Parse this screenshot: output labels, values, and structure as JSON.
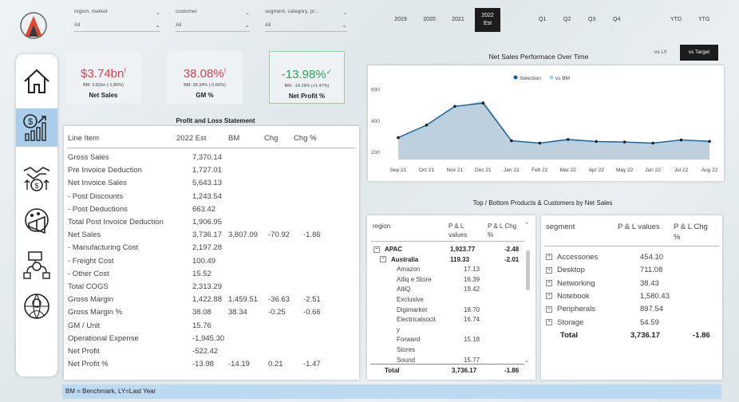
{
  "filters": [
    {
      "label": "region, market",
      "value": "All"
    },
    {
      "label": "customer",
      "value": "All"
    },
    {
      "label": "segment, category, pr...",
      "value": "All"
    }
  ],
  "years": [
    "2019",
    "2020",
    "2021"
  ],
  "year_selected": {
    "line1": "2022",
    "line2": "Est"
  },
  "quarters": [
    "Q1",
    "Q2",
    "Q3",
    "Q4"
  ],
  "period": [
    "YTD",
    "YTG"
  ],
  "nav_icons": [
    "home-icon",
    "finance-chart-icon",
    "handshake-money-icon",
    "marketing-megaphone-icon",
    "supply-chain-icon",
    "executive-globe-icon"
  ],
  "kpis": [
    {
      "value": "$3.74bn",
      "mark": "!",
      "bm": "BM: 3.81bn (-1.86%)",
      "label": "Net Sales",
      "color": "#d9434f"
    },
    {
      "value": "38.08%",
      "mark": "!",
      "bm": "BM: 38.34% (-0.66%)",
      "label": "GM %",
      "color": "#d9434f"
    },
    {
      "value": "-13.98%",
      "mark": "✓",
      "bm": "BM: -14.19% (+1.47%)",
      "label": "Net Profit %",
      "color": "#2aa35a"
    }
  ],
  "pl": {
    "title": "Profit and Loss Statement",
    "headers": {
      "item": "Line Item",
      "est": "2022 Est",
      "bm": "BM",
      "chg": "Chg",
      "chgpct": "Chg %"
    },
    "rows": [
      {
        "item": "Gross Sales",
        "est": "7,370.14",
        "bm": "",
        "chg": "",
        "chgpct": ""
      },
      {
        "item": "Pre Invoice Deduction",
        "est": "1,727.01",
        "bm": "",
        "chg": "",
        "chgpct": ""
      },
      {
        "item": "Net Invoice Sales",
        "est": "5,643.13",
        "bm": "",
        "chg": "",
        "chgpct": ""
      },
      {
        "item": "- Post Discounts",
        "est": "1,243.54",
        "bm": "",
        "chg": "",
        "chgpct": ""
      },
      {
        "item": "- Post Deductions",
        "est": "663.42",
        "bm": "",
        "chg": "",
        "chgpct": ""
      },
      {
        "item": "Total Post Invoice Deduction",
        "est": "1,906.95",
        "bm": "",
        "chg": "",
        "chgpct": ""
      },
      {
        "item": "Net Sales",
        "est": "3,736.17",
        "bm": "3,807.09",
        "chg": "-70.92",
        "chgpct": "-1.86"
      },
      {
        "item": "- Manufacturing Cost",
        "est": "2,197.28",
        "bm": "",
        "chg": "",
        "chgpct": ""
      },
      {
        "item": "- Freight Cost",
        "est": "100.49",
        "bm": "",
        "chg": "",
        "chgpct": ""
      },
      {
        "item": "- Other Cost",
        "est": "15.52",
        "bm": "",
        "chg": "",
        "chgpct": ""
      },
      {
        "item": "Total COGS",
        "est": "2,313.29",
        "bm": "",
        "chg": "",
        "chgpct": ""
      },
      {
        "item": "Gross Margin",
        "est": "1,422.88",
        "bm": "1,459.51",
        "chg": "-36.63",
        "chgpct": "-2.51"
      },
      {
        "item": "Gross Margin %",
        "est": "38.08",
        "bm": "38.34",
        "chg": "-0.25",
        "chgpct": "-0.66"
      },
      {
        "item": "GM / Unit",
        "est": "15.76",
        "bm": "",
        "chg": "",
        "chgpct": ""
      },
      {
        "item": "Operational Expense",
        "est": "-1,945.30",
        "bm": "",
        "chg": "",
        "chgpct": ""
      },
      {
        "item": "Net Profit",
        "est": "-522.42",
        "bm": "",
        "chg": "",
        "chgpct": ""
      },
      {
        "item": "Net Profit %",
        "est": "-13.98",
        "bm": "-14.19",
        "chg": "0.21",
        "chgpct": "-1.47"
      }
    ]
  },
  "toggles": {
    "ly": "vs LY",
    "target": "vs Target"
  },
  "chart_data": {
    "type": "area",
    "title": "Net Sales Performace Over Time",
    "categories": [
      "Sep 21",
      "Oct 21",
      "Nov 21",
      "Dec 21",
      "Jan 22",
      "Feb 22",
      "Mar 22",
      "Apr 22",
      "May 22",
      "Jun 22",
      "Jul 22",
      "Aug 22"
    ],
    "series": [
      {
        "name": "Selection",
        "values": [
          290,
          370,
          490,
          510,
          270,
          255,
          278,
          265,
          262,
          255,
          275,
          266
        ]
      },
      {
        "name": "vs BM",
        "values": [
          280,
          350,
          480,
          520,
          265,
          250,
          270,
          260,
          258,
          250,
          268,
          262
        ]
      }
    ],
    "yticks": [
      "200",
      "400",
      "600"
    ],
    "ylim": [
      150,
      680
    ],
    "colors": {
      "selection": "#1f5a8a",
      "bm": "#a9d4ee",
      "fill": "#aec3d6"
    }
  },
  "topbottom": {
    "title": "Top / Bottom Products & Customers by Net Sales",
    "region_table": {
      "headers": {
        "region": "region",
        "pl1": "P & L",
        "pl2": "values",
        "chg1": "P & L Chg",
        "chg2": "%"
      },
      "rows": [
        {
          "name": "APAC",
          "val": "1,923.77",
          "chg": "-2.48",
          "level": 0
        },
        {
          "name": "Australia",
          "val": "119.33",
          "chg": "-2.01",
          "level": 1
        },
        {
          "name": "Amazon",
          "val": "17.13",
          "chg": "",
          "level": 2
        },
        {
          "name": "Atliq e Store",
          "val": "16.39",
          "chg": "",
          "level": 2
        },
        {
          "name": "AtliQ",
          "val": "19.42",
          "chg": "",
          "level": 2
        },
        {
          "name": "Exclusive",
          "val": "",
          "chg": "",
          "level": 2
        },
        {
          "name": "Digimarket",
          "val": "18.70",
          "chg": "",
          "level": 2
        },
        {
          "name": "Electricalsocit",
          "val": "16.74",
          "chg": "",
          "level": 2
        },
        {
          "name": "y",
          "val": "",
          "chg": "",
          "level": 2
        },
        {
          "name": "Forward",
          "val": "15.18",
          "chg": "",
          "level": 2
        },
        {
          "name": "Stores",
          "val": "",
          "chg": "",
          "level": 2
        },
        {
          "name": "Sound",
          "val": "15.77",
          "chg": "",
          "level": 2
        }
      ],
      "total": {
        "label": "Total",
        "val": "3,736.17",
        "chg": "-1.86"
      }
    },
    "segment_table": {
      "headers": {
        "segment": "segment",
        "pl": "P & L values",
        "chg1": "P & L Chg",
        "chg2": "%"
      },
      "rows": [
        {
          "name": "Accessories",
          "val": "454.10"
        },
        {
          "name": "Desktop",
          "val": "711.08"
        },
        {
          "name": "Networking",
          "val": "38.43"
        },
        {
          "name": "Notebook",
          "val": "1,580.43"
        },
        {
          "name": "Peripherals",
          "val": "897.54"
        },
        {
          "name": "Storage",
          "val": "54.59"
        }
      ],
      "total": {
        "label": "Total",
        "val": "3,736.17",
        "chg": "-1.86"
      }
    }
  },
  "footer": "BM = Benchmark, LY=Last Year"
}
